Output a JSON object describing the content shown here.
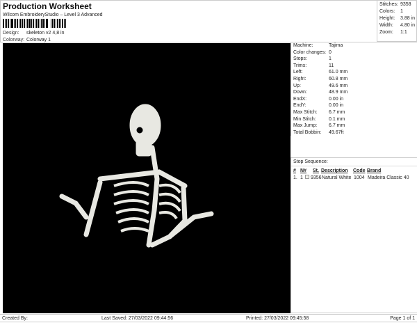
{
  "header": {
    "title": "Production Worksheet",
    "subtitle": "Wilcom EmbroideryStudio – Level 3 Advanced",
    "design_label": "Design:",
    "design": "skeleton v2 4,8 in",
    "colorway_label": "Colorway:",
    "colorway": "Colorway 1"
  },
  "summary": [
    {
      "k": "Stitches:",
      "v": "9358"
    },
    {
      "k": "Colors:",
      "v": "1"
    },
    {
      "k": "Height:",
      "v": "3.88 in"
    },
    {
      "k": "Width:",
      "v": "4.80 in"
    },
    {
      "k": "Zoom:",
      "v": "1:1"
    }
  ],
  "info": [
    {
      "k": "Machine:",
      "v": "Tajima"
    },
    {
      "k": "Color changes:",
      "v": "0"
    },
    {
      "k": "Stops:",
      "v": "1"
    },
    {
      "k": "Trims:",
      "v": "11"
    },
    {
      "k": "Left:",
      "v": "61.0 mm"
    },
    {
      "k": "Right:",
      "v": "60.8 mm"
    },
    {
      "k": "Up:",
      "v": "49.6 mm"
    },
    {
      "k": "Down:",
      "v": "48.9 mm"
    },
    {
      "k": "EndX:",
      "v": "0.00 in"
    },
    {
      "k": "EndY:",
      "v": "0.00 in"
    },
    {
      "k": "Max Stitch:",
      "v": "6.7 mm"
    },
    {
      "k": "Min Stitch:",
      "v": "0.1 mm"
    },
    {
      "k": "Max Jump:",
      "v": "6.7 mm"
    },
    {
      "k": "Total Bobbin:",
      "v": "49.67ft"
    }
  ],
  "stops": {
    "title": "Stop Sequence:",
    "headers": [
      "#",
      "N#",
      "St.",
      "Description",
      "Code",
      "Brand"
    ],
    "rows": [
      {
        "num": "1.",
        "n": "1",
        "st": "9356",
        "desc": "Natural White",
        "code": "1004",
        "brand": "Madeira Classic 40",
        "color": "#f2f2ec"
      }
    ]
  },
  "footer": {
    "created": "Created By:",
    "saved": "Last Saved: 27/03/2022 09:44:56",
    "printed": "Printed: 27/03/2022 09:45:58",
    "page": "Page 1 of 1"
  }
}
